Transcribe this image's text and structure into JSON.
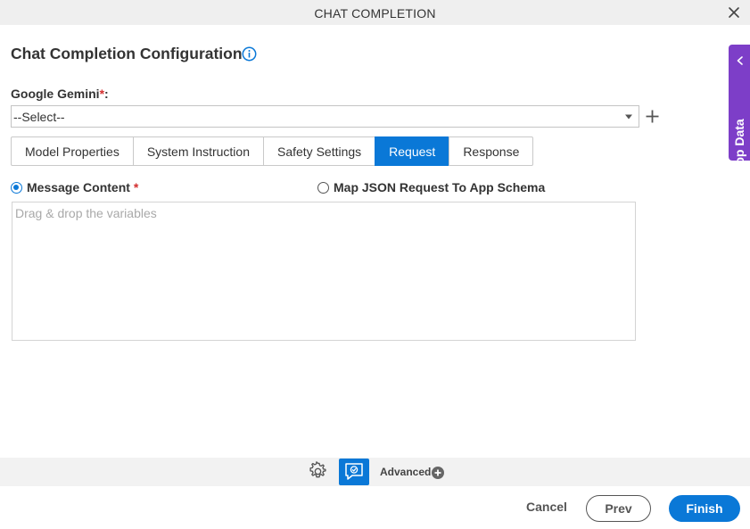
{
  "window": {
    "title": "CHAT COMPLETION",
    "close_icon": "close-icon"
  },
  "page": {
    "heading": "Chat Completion Configuration",
    "info_icon": "info-icon"
  },
  "connection": {
    "label": "Google Gemini",
    "required_mark": "*",
    "label_suffix": ":",
    "selected_value": "--Select--",
    "add_icon": "plus-icon"
  },
  "tabs": [
    {
      "label": "Model Properties",
      "active": false
    },
    {
      "label": "System Instruction",
      "active": false
    },
    {
      "label": "Safety Settings",
      "active": false
    },
    {
      "label": "Request",
      "active": true
    },
    {
      "label": "Response",
      "active": false
    }
  ],
  "request": {
    "options": [
      {
        "label": "Message Content",
        "required_mark": "*",
        "selected": true
      },
      {
        "label": "Map JSON Request To App Schema",
        "selected": false
      }
    ],
    "message_placeholder": "Drag & drop the variables"
  },
  "side_panel": {
    "label": "App Data",
    "icon": "chevron-left-icon"
  },
  "toolbar": {
    "settings_icon": "gear-icon",
    "chat_icon": "chat-icon",
    "advanced_label": "Advanced",
    "advanced_icon": "plus-circle-icon"
  },
  "footer": {
    "cancel_label": "Cancel",
    "prev_label": "Prev",
    "finish_label": "Finish"
  },
  "colors": {
    "accent": "#0a78d7",
    "side_tab": "#7d3ec8",
    "required": "#d32f2f"
  }
}
